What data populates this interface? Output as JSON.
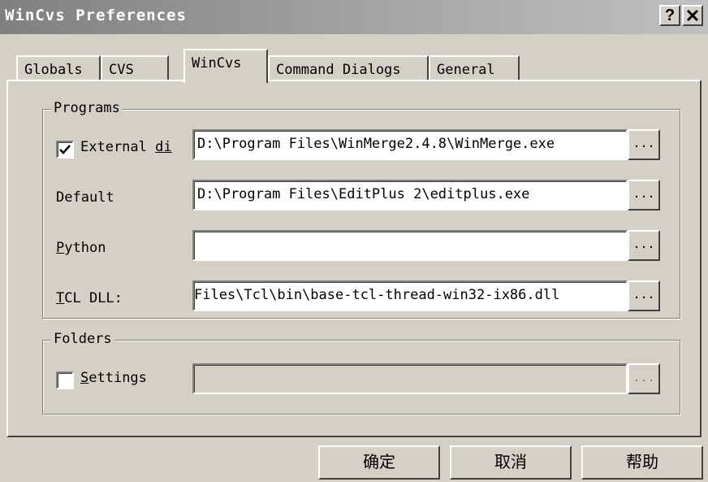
{
  "window": {
    "title": "WinCvs Preferences",
    "help_button": "?",
    "close_button": "✕"
  },
  "tabs": [
    {
      "label": "Globals",
      "active": false
    },
    {
      "label": "CVS",
      "active": false
    },
    {
      "label": "WinCvs",
      "active": true
    },
    {
      "label": "Command Dialogs",
      "active": false
    },
    {
      "label": "General",
      "active": false
    }
  ],
  "programs": {
    "group_label": "Programs",
    "external_diff": {
      "checked": true,
      "label_prefix": "External ",
      "label_underlined": "di",
      "value": "D:\\Program Files\\WinMerge2.4.8\\WinMerge.exe",
      "browse_label": "..."
    },
    "default_editor": {
      "label": "Default",
      "value": "D:\\Program Files\\EditPlus 2\\editplus.exe",
      "browse_label": "..."
    },
    "python": {
      "label_underlined": "P",
      "label_rest": "ython",
      "value": "",
      "browse_label": "..."
    },
    "tcl_dll": {
      "label_underlined": "T",
      "label_rest": "CL DLL:",
      "value": "Files\\Tcl\\bin\\base-tcl-thread-win32-ix86.dll",
      "browse_label": "..."
    }
  },
  "folders": {
    "group_label": "Folders",
    "settings": {
      "checked": false,
      "label_underlined": "S",
      "label_rest": "ettings",
      "value": "",
      "browse_label": "..."
    }
  },
  "buttons": {
    "ok": "确定",
    "cancel": "取消",
    "help": "帮助"
  }
}
